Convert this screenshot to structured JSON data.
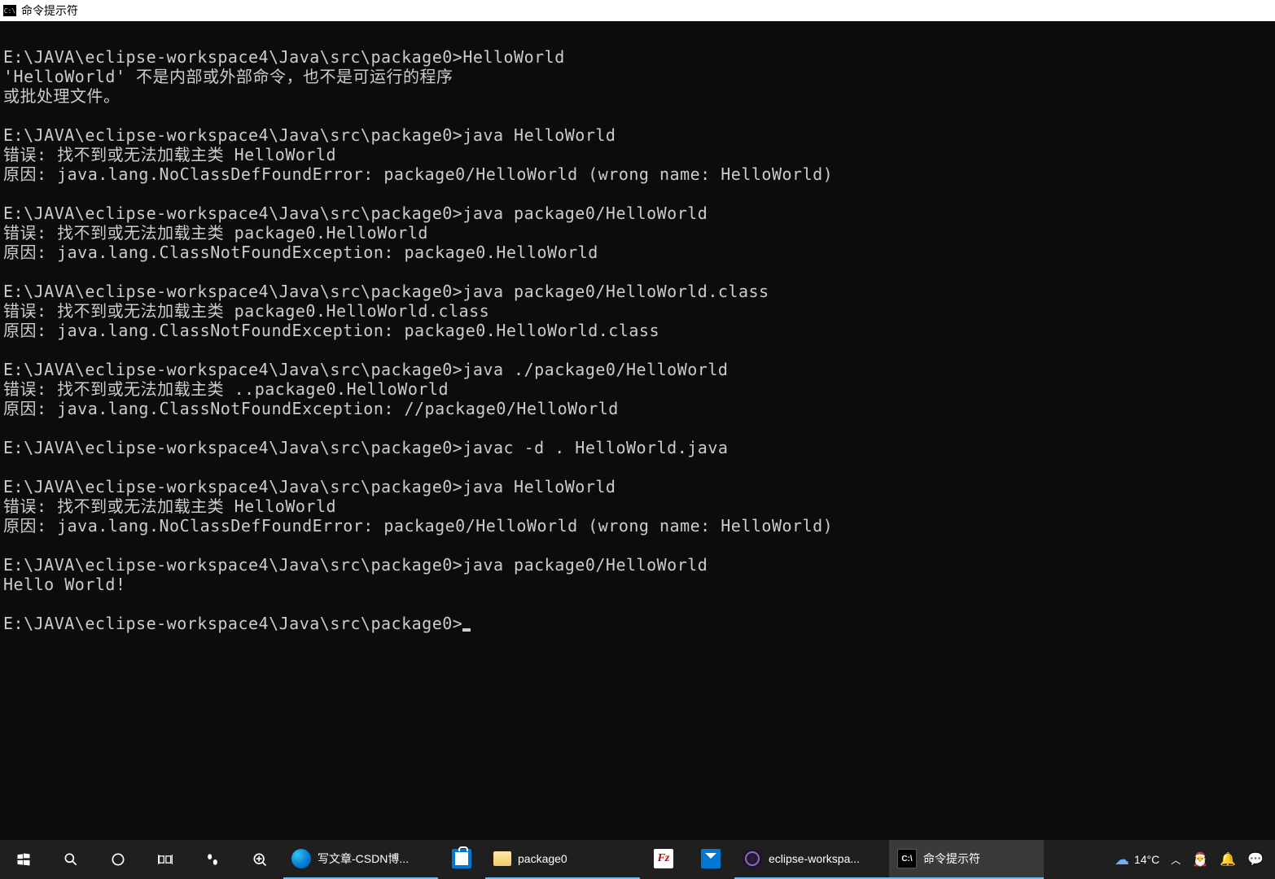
{
  "window": {
    "title": "命令提示符",
    "icon_label": "C:\\"
  },
  "terminal": {
    "blocks": [
      "",
      "E:\\JAVA\\eclipse-workspace4\\Java\\src\\package0>HelloWorld",
      "'HelloWorld' 不是内部或外部命令，也不是可运行的程序",
      "或批处理文件。",
      "",
      "E:\\JAVA\\eclipse-workspace4\\Java\\src\\package0>java HelloWorld",
      "错误: 找不到或无法加载主类 HelloWorld",
      "原因: java.lang.NoClassDefFoundError: package0/HelloWorld (wrong name: HelloWorld)",
      "",
      "E:\\JAVA\\eclipse-workspace4\\Java\\src\\package0>java package0/HelloWorld",
      "错误: 找不到或无法加载主类 package0.HelloWorld",
      "原因: java.lang.ClassNotFoundException: package0.HelloWorld",
      "",
      "E:\\JAVA\\eclipse-workspace4\\Java\\src\\package0>java package0/HelloWorld.class",
      "错误: 找不到或无法加载主类 package0.HelloWorld.class",
      "原因: java.lang.ClassNotFoundException: package0.HelloWorld.class",
      "",
      "E:\\JAVA\\eclipse-workspace4\\Java\\src\\package0>java ./package0/HelloWorld",
      "错误: 找不到或无法加载主类 ..package0.HelloWorld",
      "原因: java.lang.ClassNotFoundException: //package0/HelloWorld",
      "",
      "E:\\JAVA\\eclipse-workspace4\\Java\\src\\package0>javac -d . HelloWorld.java",
      "",
      "E:\\JAVA\\eclipse-workspace4\\Java\\src\\package0>java HelloWorld",
      "错误: 找不到或无法加载主类 HelloWorld",
      "原因: java.lang.NoClassDefFoundError: package0/HelloWorld (wrong name: HelloWorld)",
      "",
      "E:\\JAVA\\eclipse-workspace4\\Java\\src\\package0>java package0/HelloWorld",
      "Hello World!",
      ""
    ],
    "current_prompt": "E:\\JAVA\\eclipse-workspace4\\Java\\src\\package0>"
  },
  "taskbar": {
    "apps": [
      {
        "name": "edge",
        "label": "写文章-CSDN博..."
      },
      {
        "name": "store",
        "label": ""
      },
      {
        "name": "folder",
        "label": "package0"
      },
      {
        "name": "filezilla",
        "label": ""
      },
      {
        "name": "mail",
        "label": ""
      },
      {
        "name": "eclipse",
        "label": "eclipse-workspa..."
      },
      {
        "name": "cmd",
        "label": "命令提示符"
      }
    ],
    "tray": {
      "temperature": "14°C"
    }
  }
}
